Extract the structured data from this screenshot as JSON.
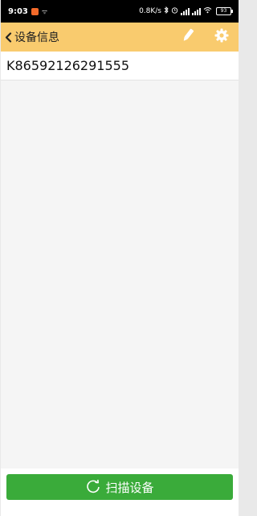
{
  "status_bar": {
    "time": "9:03",
    "network_speed": "0.8K/s",
    "battery_level": "93",
    "icons": [
      "notification-app-icon",
      "wifi-small-icon",
      "bluetooth-icon",
      "alarm-icon",
      "signal-icon",
      "signal-icon",
      "wifi-icon",
      "battery-icon"
    ]
  },
  "app_bar": {
    "title": "设备信息",
    "background_color": "#f9cb6e",
    "icons": [
      "back-chevron-icon",
      "pencil-icon",
      "gear-icon"
    ]
  },
  "device_list": [
    {
      "id": "K86592126291555"
    }
  ],
  "footer": {
    "scan_label": "扫描设备",
    "button_color": "#3aab3a",
    "icon": "refresh-icon"
  }
}
